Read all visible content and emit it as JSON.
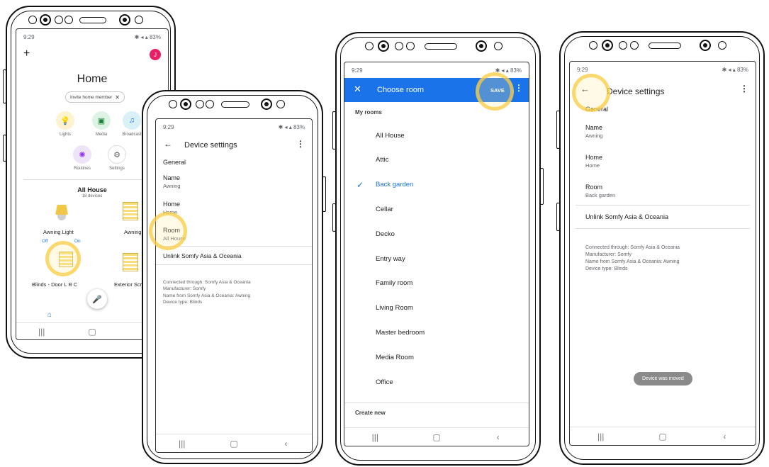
{
  "status": {
    "time": "9:29",
    "battery": "83%"
  },
  "home_screen": {
    "title": "Home",
    "invite_chip": "Invite home member",
    "favorites": [
      {
        "label": "Lights",
        "icon": "lightbulb-icon"
      },
      {
        "label": "Media",
        "icon": "play-icon"
      },
      {
        "label": "Broadcast",
        "icon": "broadcast-icon"
      },
      {
        "label": "Routines",
        "icon": "sun-icon"
      },
      {
        "label": "Settings",
        "icon": "gear-icon"
      }
    ],
    "section_title": "All House",
    "section_subtitle": "18 devices",
    "devices": [
      {
        "label": "Awning Light"
      },
      {
        "label": "Awning"
      },
      {
        "label": "Blinds - Door L R C"
      },
      {
        "label": "Exterior Scr"
      }
    ],
    "off_label": "Off",
    "on_label": "On",
    "avatar_letter": "J"
  },
  "device_settings_before": {
    "title": "Device settings",
    "general": "General",
    "name_label": "Name",
    "name_value": "Awning",
    "home_label": "Home",
    "home_value": "Home",
    "room_label": "Room",
    "room_value": "All House",
    "unlink": "Unlink Somfy Asia & Oceania",
    "info": [
      "Connected through: Somfy Asia & Oceania",
      "Manufacturer: Somfy",
      "Name from Somfy Asia & Oceania: Awning",
      "Device type: Blinds"
    ]
  },
  "choose_room": {
    "title": "Choose room",
    "save": "SAVE",
    "my_rooms": "My rooms",
    "rooms": [
      "All House",
      "Attic",
      "Back garden",
      "Cellar",
      "Decko",
      "Entry way",
      "Family room",
      "Living Room",
      "Master bedroom",
      "Media Room",
      "Office"
    ],
    "selected_room": "Back garden",
    "create_new": "Create new",
    "accent_color": "#1a73e8"
  },
  "device_settings_after": {
    "title": "Device settings",
    "general": "General",
    "name_label": "Name",
    "name_value": "Awning",
    "home_label": "Home",
    "home_value": "Home",
    "room_label": "Room",
    "room_value": "Back garden",
    "unlink": "Unlink Somfy Asia & Oceania",
    "info": [
      "Connected through: Somfy Asia & Oceania",
      "Manufacturer: Somfy",
      "Name from Somfy Asia & Oceania: Awning",
      "Device type: Blinds"
    ],
    "toast": "Device was moved"
  }
}
